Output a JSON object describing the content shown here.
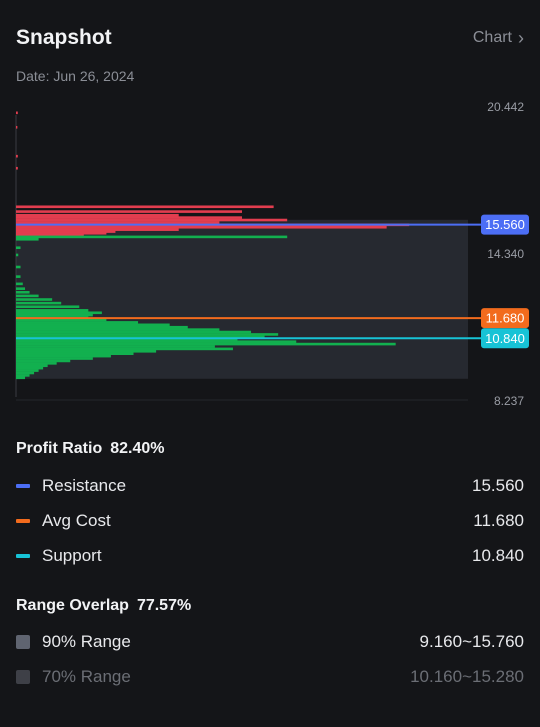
{
  "header": {
    "title": "Snapshot",
    "chart_link": "Chart",
    "date": "Date: Jun 26, 2024"
  },
  "axis": {
    "top": "20.442",
    "mid": "14.340",
    "bottom": "8.237",
    "min": 8.237,
    "max": 20.442
  },
  "markers": [
    {
      "name": "resistance",
      "value": 15.56,
      "label": "15.560",
      "color": "#4c6ef5"
    },
    {
      "name": "avg-cost",
      "value": 11.68,
      "label": "11.680",
      "color": "#f26b1d"
    },
    {
      "name": "support",
      "value": 10.84,
      "label": "10.840",
      "color": "#17c3d6"
    }
  ],
  "ranges": {
    "r90": [
      9.16,
      15.76
    ],
    "r70": [
      10.16,
      15.28
    ]
  },
  "profit": {
    "label": "Profit Ratio",
    "value": "82.40%"
  },
  "legend": [
    {
      "label": "Resistance",
      "value": "15.560",
      "color": "#4c6ef5"
    },
    {
      "label": "Avg Cost",
      "value": "11.680",
      "color": "#f26b1d"
    },
    {
      "label": "Support",
      "value": "10.840",
      "color": "#17c3d6"
    }
  ],
  "overlap": {
    "label": "Range Overlap",
    "value": "77.57%"
  },
  "range_rows": [
    {
      "label": "90% Range",
      "value": "9.160~15.760",
      "color": "#5f6470"
    },
    {
      "label": "70% Range",
      "value": "10.160~15.280",
      "color": "#3e4047"
    }
  ],
  "colors": {
    "profit": "#12b04f",
    "loss": "#e23d4f"
  },
  "chart_data": {
    "type": "bar",
    "orientation": "horizontal",
    "ylim": [
      8.237,
      20.442
    ],
    "loss_bars": [
      [
        20.2,
        0.004
      ],
      [
        19.6,
        0.003
      ],
      [
        18.4,
        0.004
      ],
      [
        17.9,
        0.004
      ],
      [
        16.3,
        0.57
      ],
      [
        16.1,
        0.5
      ],
      [
        15.95,
        0.36
      ],
      [
        15.85,
        0.5
      ],
      [
        15.75,
        0.6
      ],
      [
        15.65,
        0.45
      ],
      [
        15.55,
        0.87
      ],
      [
        15.45,
        0.82
      ],
      [
        15.35,
        0.36
      ],
      [
        15.27,
        0.22
      ],
      [
        15.2,
        0.2
      ],
      [
        15.13,
        0.15
      ]
    ],
    "profit_bars": [
      [
        15.05,
        0.6
      ],
      [
        14.95,
        0.05
      ],
      [
        14.6,
        0.01
      ],
      [
        14.3,
        0.005
      ],
      [
        13.8,
        0.01
      ],
      [
        13.4,
        0.01
      ],
      [
        13.1,
        0.015
      ],
      [
        12.9,
        0.02
      ],
      [
        12.75,
        0.03
      ],
      [
        12.6,
        0.05
      ],
      [
        12.45,
        0.08
      ],
      [
        12.3,
        0.1
      ],
      [
        12.15,
        0.14
      ],
      [
        12.0,
        0.16
      ],
      [
        11.9,
        0.19
      ],
      [
        11.8,
        0.17
      ],
      [
        11.7,
        0.16
      ],
      [
        11.6,
        0.2
      ],
      [
        11.5,
        0.27
      ],
      [
        11.4,
        0.34
      ],
      [
        11.3,
        0.38
      ],
      [
        11.2,
        0.45
      ],
      [
        11.1,
        0.52
      ],
      [
        11.0,
        0.58
      ],
      [
        10.9,
        0.55
      ],
      [
        10.8,
        0.49
      ],
      [
        10.7,
        0.62
      ],
      [
        10.6,
        0.84
      ],
      [
        10.5,
        0.44
      ],
      [
        10.4,
        0.48
      ],
      [
        10.3,
        0.31
      ],
      [
        10.2,
        0.26
      ],
      [
        10.1,
        0.21
      ],
      [
        10.0,
        0.17
      ],
      [
        9.9,
        0.12
      ],
      [
        9.8,
        0.09
      ],
      [
        9.7,
        0.07
      ],
      [
        9.6,
        0.06
      ],
      [
        9.5,
        0.05
      ],
      [
        9.4,
        0.04
      ],
      [
        9.3,
        0.03
      ],
      [
        9.2,
        0.02
      ]
    ]
  }
}
